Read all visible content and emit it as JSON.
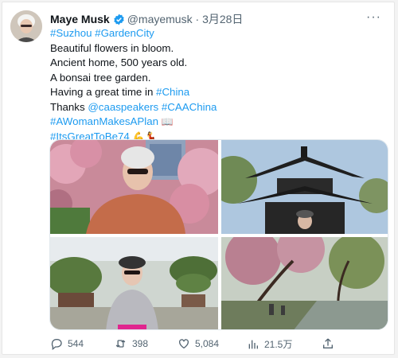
{
  "tweet": {
    "author_name": "Maye Musk",
    "handle": "@mayemusk",
    "date": "3月28日",
    "text": {
      "tags1": "#Suzhou #GardenCity",
      "line2": "Beautiful flowers in bloom.",
      "line3": "Ancient home, 500 years old.",
      "line4": "A bonsai tree garden.",
      "line5_prefix": "Having a great time in ",
      "line5_tag": "#China",
      "line6_prefix": "Thanks ",
      "line6_links": "@caaspeakers #CAAChina",
      "line7_tag": "#AWomanMakesAPlan",
      "line7_emoji": "📖",
      "line8_tag": "#ItsGreatToBe74",
      "line8_emoji": "💪💃"
    }
  },
  "actions": {
    "replies": "544",
    "retweets": "398",
    "likes": "5,084",
    "views": "21.5万"
  },
  "icons": [
    "verified-badge-icon",
    "more-icon",
    "reply-icon",
    "retweet-icon",
    "like-icon",
    "views-icon",
    "share-icon"
  ],
  "colors": {
    "link": "#1d9bf0",
    "text": "#0f1419",
    "muted": "#536471"
  }
}
